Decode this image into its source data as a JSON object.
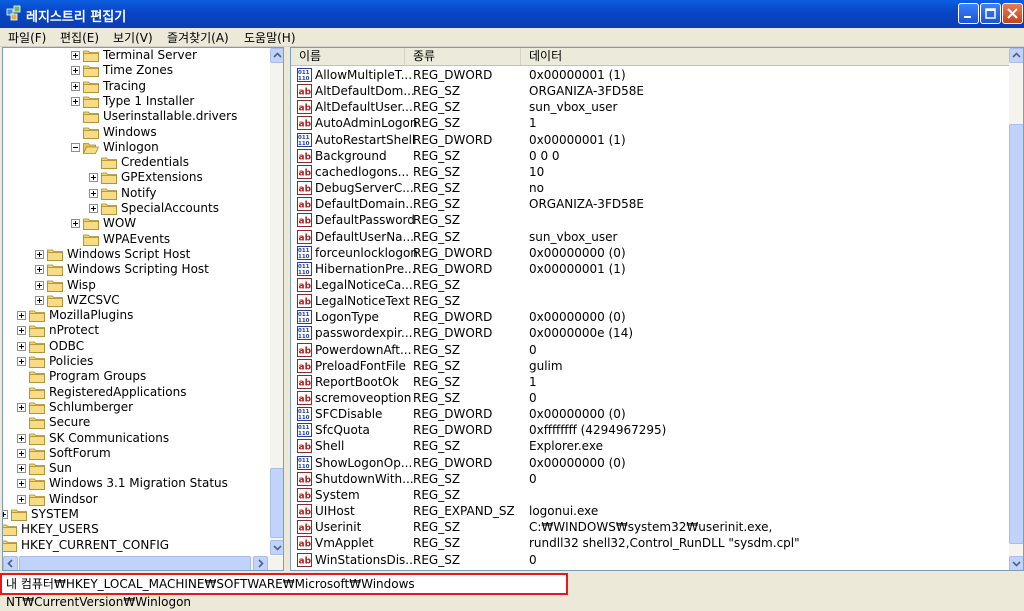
{
  "window": {
    "title": "레지스트리 편집기"
  },
  "menu": [
    "파일(F)",
    "편집(E)",
    "보기(V)",
    "즐겨찾기(A)",
    "도움말(H)"
  ],
  "tree": [
    {
      "label": "Terminal Server",
      "expander": "plus"
    },
    {
      "label": "Time Zones",
      "expander": "plus"
    },
    {
      "label": "Tracing",
      "expander": "plus"
    },
    {
      "label": "Type 1 Installer",
      "expander": "plus"
    },
    {
      "label": "Userinstallable.drivers",
      "expander": "none"
    },
    {
      "label": "Windows",
      "expander": "none"
    },
    {
      "label": "Winlogon",
      "expander": "minus",
      "open": true
    },
    {
      "label": "Credentials",
      "expander": "none"
    },
    {
      "label": "GPExtensions",
      "expander": "plus"
    },
    {
      "label": "Notify",
      "expander": "plus"
    },
    {
      "label": "SpecialAccounts",
      "expander": "plus"
    },
    {
      "label": "WOW",
      "expander": "plus"
    },
    {
      "label": "WPAEvents",
      "expander": "none"
    },
    {
      "label": "Windows Script Host",
      "expander": "plus"
    },
    {
      "label": "Windows Scripting Host",
      "expander": "plus"
    },
    {
      "label": "Wisp",
      "expander": "plus"
    },
    {
      "label": "WZCSVC",
      "expander": "plus"
    },
    {
      "label": "MozillaPlugins",
      "expander": "plus"
    },
    {
      "label": "nProtect",
      "expander": "plus"
    },
    {
      "label": "ODBC",
      "expander": "plus"
    },
    {
      "label": "Policies",
      "expander": "plus"
    },
    {
      "label": "Program Groups",
      "expander": "none"
    },
    {
      "label": "RegisteredApplications",
      "expander": "none"
    },
    {
      "label": "Schlumberger",
      "expander": "plus"
    },
    {
      "label": "Secure",
      "expander": "none"
    },
    {
      "label": "SK Communications",
      "expander": "plus"
    },
    {
      "label": "SoftForum",
      "expander": "plus"
    },
    {
      "label": "Sun",
      "expander": "plus"
    },
    {
      "label": "Windows 3.1 Migration Status",
      "expander": "plus"
    },
    {
      "label": "Windsor",
      "expander": "plus"
    },
    {
      "label": "SYSTEM",
      "expander": "plus"
    },
    {
      "label": "HKEY_USERS",
      "expander": "plus"
    },
    {
      "label": "HKEY_CURRENT_CONFIG",
      "expander": "plus"
    }
  ],
  "list": {
    "headers": {
      "name": "이름",
      "type": "종류",
      "data": "데이터"
    },
    "rows": [
      {
        "icon": "dword",
        "name": "AllowMultipleT...",
        "type": "REG_DWORD",
        "data": "0x00000001 (1)"
      },
      {
        "icon": "sz",
        "name": "AltDefaultDom...",
        "type": "REG_SZ",
        "data": "ORGANIZA-3FD58E"
      },
      {
        "icon": "sz",
        "name": "AltDefaultUser...",
        "type": "REG_SZ",
        "data": "sun_vbox_user"
      },
      {
        "icon": "sz",
        "name": "AutoAdminLogon",
        "type": "REG_SZ",
        "data": "1"
      },
      {
        "icon": "dword",
        "name": "AutoRestartShell",
        "type": "REG_DWORD",
        "data": "0x00000001 (1)"
      },
      {
        "icon": "sz",
        "name": "Background",
        "type": "REG_SZ",
        "data": "0 0 0"
      },
      {
        "icon": "sz",
        "name": "cachedlogons...",
        "type": "REG_SZ",
        "data": "10"
      },
      {
        "icon": "sz",
        "name": "DebugServerC...",
        "type": "REG_SZ",
        "data": "no"
      },
      {
        "icon": "sz",
        "name": "DefaultDomain...",
        "type": "REG_SZ",
        "data": "ORGANIZA-3FD58E"
      },
      {
        "icon": "sz",
        "name": "DefaultPassword",
        "type": "REG_SZ",
        "data": ""
      },
      {
        "icon": "sz",
        "name": "DefaultUserNa...",
        "type": "REG_SZ",
        "data": "sun_vbox_user"
      },
      {
        "icon": "dword",
        "name": "forceunlocklogon",
        "type": "REG_DWORD",
        "data": "0x00000000 (0)"
      },
      {
        "icon": "dword",
        "name": "HibernationPre...",
        "type": "REG_DWORD",
        "data": "0x00000001 (1)"
      },
      {
        "icon": "sz",
        "name": "LegalNoticeCa...",
        "type": "REG_SZ",
        "data": ""
      },
      {
        "icon": "sz",
        "name": "LegalNoticeText",
        "type": "REG_SZ",
        "data": ""
      },
      {
        "icon": "dword",
        "name": "LogonType",
        "type": "REG_DWORD",
        "data": "0x00000000 (0)"
      },
      {
        "icon": "dword",
        "name": "passwordexpir...",
        "type": "REG_DWORD",
        "data": "0x0000000e (14)"
      },
      {
        "icon": "sz",
        "name": "PowerdownAft...",
        "type": "REG_SZ",
        "data": "0"
      },
      {
        "icon": "sz",
        "name": "PreloadFontFile",
        "type": "REG_SZ",
        "data": "gulim"
      },
      {
        "icon": "sz",
        "name": "ReportBootOk",
        "type": "REG_SZ",
        "data": "1"
      },
      {
        "icon": "sz",
        "name": "scremoveoption",
        "type": "REG_SZ",
        "data": "0"
      },
      {
        "icon": "dword",
        "name": "SFCDisable",
        "type": "REG_DWORD",
        "data": "0x00000000 (0)"
      },
      {
        "icon": "dword",
        "name": "SfcQuota",
        "type": "REG_DWORD",
        "data": "0xffffffff (4294967295)"
      },
      {
        "icon": "sz",
        "name": "Shell",
        "type": "REG_SZ",
        "data": "Explorer.exe"
      },
      {
        "icon": "dword",
        "name": "ShowLogonOp...",
        "type": "REG_DWORD",
        "data": "0x00000000 (0)"
      },
      {
        "icon": "sz",
        "name": "ShutdownWith...",
        "type": "REG_SZ",
        "data": "0"
      },
      {
        "icon": "sz",
        "name": "System",
        "type": "REG_SZ",
        "data": ""
      },
      {
        "icon": "sz",
        "name": "UIHost",
        "type": "REG_EXPAND_SZ",
        "data": "logonui.exe"
      },
      {
        "icon": "sz",
        "name": "Userinit",
        "type": "REG_SZ",
        "data": "C:₩WINDOWS₩system32₩userinit.exe,"
      },
      {
        "icon": "sz",
        "name": "VmApplet",
        "type": "REG_SZ",
        "data": "rundll32 shell32,Control_RunDLL \"sysdm.cpl\""
      },
      {
        "icon": "sz",
        "name": "WinStationsDis...",
        "type": "REG_SZ",
        "data": "0"
      }
    ]
  },
  "status": {
    "path": "내 컴퓨터₩HKEY_LOCAL_MACHINE₩SOFTWARE₩Microsoft₩Windows NT₩CurrentVersion₩Winlogon"
  },
  "colors": {
    "titlebar": "#0847c8",
    "highlight_border": "#e3191b",
    "folder": "#f3d36b"
  }
}
